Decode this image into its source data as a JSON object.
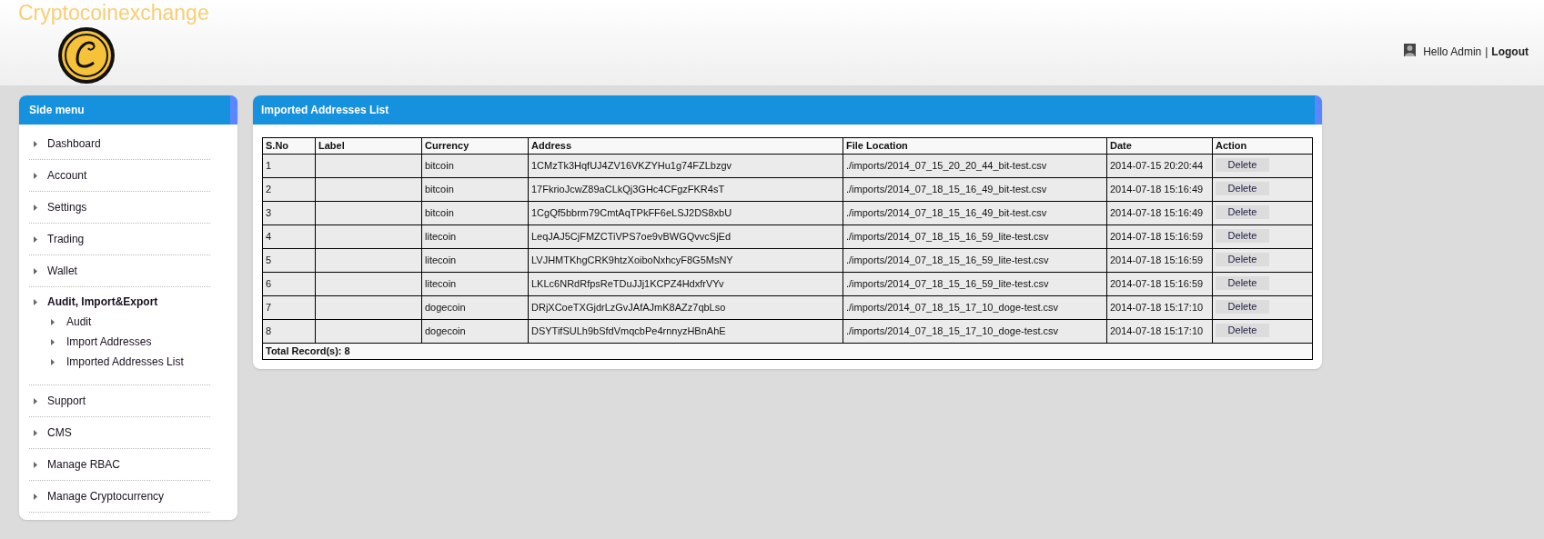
{
  "header": {
    "brand": "Cryptocoinexchange",
    "greeting": "Hello Admin",
    "separator": "|",
    "logout": "Logout"
  },
  "sidebar": {
    "title": "Side menu",
    "items": [
      {
        "label": "Dashboard",
        "expanded": false
      },
      {
        "label": "Account",
        "expanded": false
      },
      {
        "label": "Settings",
        "expanded": false
      },
      {
        "label": "Trading",
        "expanded": false
      },
      {
        "label": "Wallet",
        "expanded": false
      },
      {
        "label": "Audit, Import&Export",
        "expanded": true,
        "children": [
          {
            "label": "Audit"
          },
          {
            "label": "Import Addresses"
          },
          {
            "label": "Imported Addresses List"
          }
        ]
      },
      {
        "label": "Support",
        "expanded": false
      },
      {
        "label": "CMS",
        "expanded": false
      },
      {
        "label": "Manage RBAC",
        "expanded": false
      },
      {
        "label": "Manage Cryptocurrency",
        "expanded": false
      }
    ]
  },
  "panel": {
    "title": "Imported Addresses List"
  },
  "table": {
    "columns": [
      "S.No",
      "Label",
      "Currency",
      "Address",
      "File Location",
      "Date",
      "Action"
    ],
    "rows": [
      {
        "sno": "1",
        "label": "",
        "currency": "bitcoin",
        "address": "1CMzTk3HqfUJ4ZV16VKZYHu1g74FZLbzgv",
        "file": "./imports/2014_07_15_20_20_44_bit-test.csv",
        "date": "2014-07-15 20:20:44",
        "action": "Delete"
      },
      {
        "sno": "2",
        "label": "",
        "currency": "bitcoin",
        "address": "17FkrioJcwZ89aCLkQj3GHc4CFgzFKR4sT",
        "file": "./imports/2014_07_18_15_16_49_bit-test.csv",
        "date": "2014-07-18 15:16:49",
        "action": "Delete"
      },
      {
        "sno": "3",
        "label": "",
        "currency": "bitcoin",
        "address": "1CgQf5bbrm79CmtAqTPkFF6eLSJ2DS8xbU",
        "file": "./imports/2014_07_18_15_16_49_bit-test.csv",
        "date": "2014-07-18 15:16:49",
        "action": "Delete"
      },
      {
        "sno": "4",
        "label": "",
        "currency": "litecoin",
        "address": "LeqJAJ5CjFMZCTiVPS7oe9vBWGQvvcSjEd",
        "file": "./imports/2014_07_18_15_16_59_lite-test.csv",
        "date": "2014-07-18 15:16:59",
        "action": "Delete"
      },
      {
        "sno": "5",
        "label": "",
        "currency": "litecoin",
        "address": "LVJHMTKhgCRK9htzXoiboNxhcyF8G5MsNY",
        "file": "./imports/2014_07_18_15_16_59_lite-test.csv",
        "date": "2014-07-18 15:16:59",
        "action": "Delete"
      },
      {
        "sno": "6",
        "label": "",
        "currency": "litecoin",
        "address": "LKLc6NRdRfpsReTDuJJj1KCPZ4HdxfrVYv",
        "file": "./imports/2014_07_18_15_16_59_lite-test.csv",
        "date": "2014-07-18 15:16:59",
        "action": "Delete"
      },
      {
        "sno": "7",
        "label": "",
        "currency": "dogecoin",
        "address": "DRjXCoeTXGjdrLzGvJAfAJmK8AZz7qbLso",
        "file": "./imports/2014_07_18_15_17_10_doge-test.csv",
        "date": "2014-07-18 15:17:10",
        "action": "Delete"
      },
      {
        "sno": "8",
        "label": "",
        "currency": "dogecoin",
        "address": "DSYTifSULh9bSfdVmqcbPe4rnnyzHBnAhE",
        "file": "./imports/2014_07_18_15_17_10_doge-test.csv",
        "date": "2014-07-18 15:17:10",
        "action": "Delete"
      }
    ],
    "total": "Total Record(s): 8"
  }
}
